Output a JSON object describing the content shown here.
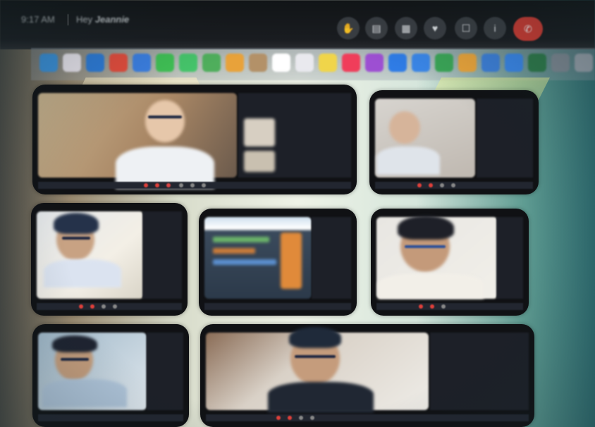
{
  "topbar": {
    "time": "9:17 AM",
    "meeting_prefix": "Hey",
    "meeting_name": "Jeannie",
    "controls": [
      {
        "icon": "raise-hand-icon",
        "glyph": "✋"
      },
      {
        "icon": "share-icon",
        "glyph": "▤"
      },
      {
        "icon": "layout-icon",
        "glyph": "▦"
      },
      {
        "icon": "react-icon",
        "glyph": "♥"
      },
      {
        "icon": "rooms-icon",
        "glyph": "☐"
      },
      {
        "icon": "info-icon",
        "glyph": "i"
      },
      {
        "icon": "end-call-icon",
        "glyph": "✆"
      }
    ]
  },
  "dock": {
    "apps": [
      "finder-icon",
      "launchpad-icon",
      "safari-icon",
      "chrome-icon",
      "mail-icon",
      "facetime-icon",
      "messages-icon",
      "maps-icon",
      "photos-icon",
      "contacts-icon",
      "calendar-icon",
      "reminders-icon",
      "notes-icon",
      "music-icon",
      "podcasts-icon",
      "appstore-icon",
      "zoom-icon",
      "sheets-icon",
      "pages-icon",
      "keynote-icon",
      "appstore-2-icon",
      "starbucks-icon",
      "settings-icon",
      "trash-icon"
    ],
    "colors": [
      "#3a8fd8",
      "#e9e4ec",
      "#2d7ad6",
      "#e34b3b",
      "#3b7ee0",
      "#3fbf54",
      "#45c46a",
      "#4fae5c",
      "#e8a23a",
      "#b39168",
      "#ffffff",
      "#e9e9ee",
      "#f0d54a",
      "#f03d5a",
      "#9d4fd2",
      "#2f7ce6",
      "#3a86e8",
      "#3aa556",
      "#e9a33a",
      "#3d7fd8",
      "#3a86e8",
      "#2e7a4a",
      "#808a94",
      "#9aa3ad"
    ]
  },
  "accents": {
    "end_call": "#d23b32",
    "tile_bg": "#101114",
    "toolbar_red": "#e0403a"
  },
  "tiles": [
    {
      "name": "student-tile-1"
    },
    {
      "name": "student-tile-2"
    },
    {
      "name": "student-tile-3"
    },
    {
      "name": "screen-share-tile"
    },
    {
      "name": "student-tile-4"
    },
    {
      "name": "student-tile-5"
    },
    {
      "name": "student-tile-6"
    }
  ]
}
